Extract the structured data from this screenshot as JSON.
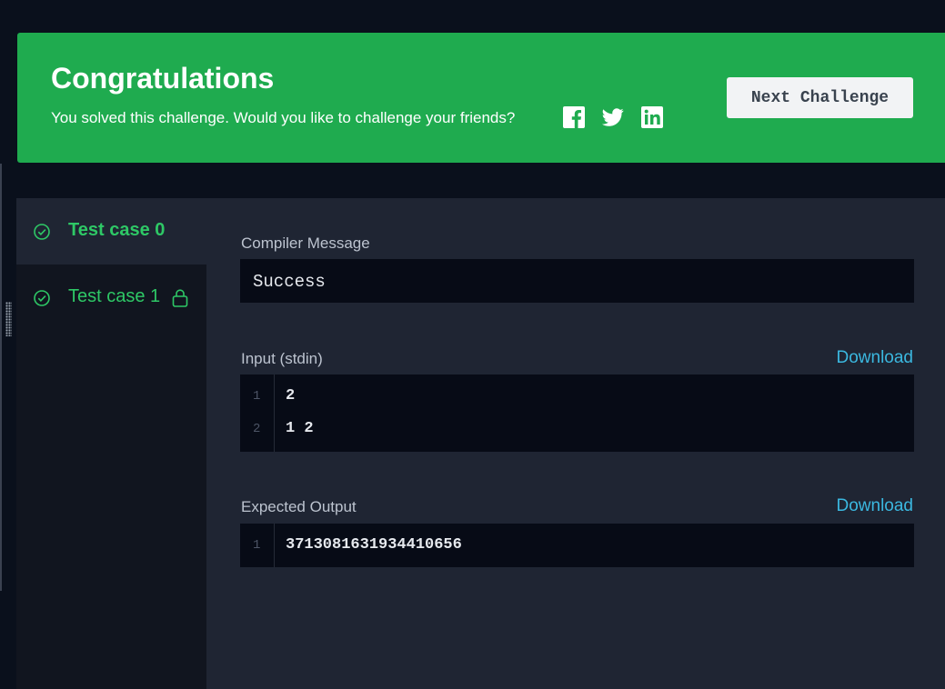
{
  "banner": {
    "title": "Congratulations",
    "subtitle": "You solved this challenge. Would you like to challenge your friends?",
    "share_icons": [
      "facebook-icon",
      "twitter-icon",
      "linkedin-icon"
    ],
    "next_button_label": "Next Challenge",
    "background_color": "#1fab4f"
  },
  "test_cases": [
    {
      "label": "Test case 0",
      "status": "passed",
      "locked": false,
      "active": true
    },
    {
      "label": "Test case 1",
      "status": "passed",
      "locked": true,
      "active": false
    }
  ],
  "compiler": {
    "label": "Compiler Message",
    "message": "Success"
  },
  "input": {
    "label": "Input (stdin)",
    "download_label": "Download",
    "lines": [
      {
        "num": "1",
        "text": "2"
      },
      {
        "num": "2",
        "text": "1 2"
      }
    ]
  },
  "expected_output": {
    "label": "Expected Output",
    "download_label": "Download",
    "lines": [
      {
        "num": "1",
        "text": "3713081631934410656"
      }
    ]
  },
  "colors": {
    "accent_green": "#2ec866",
    "link_blue": "#3bb8e0",
    "panel_bg": "#1f2533"
  }
}
